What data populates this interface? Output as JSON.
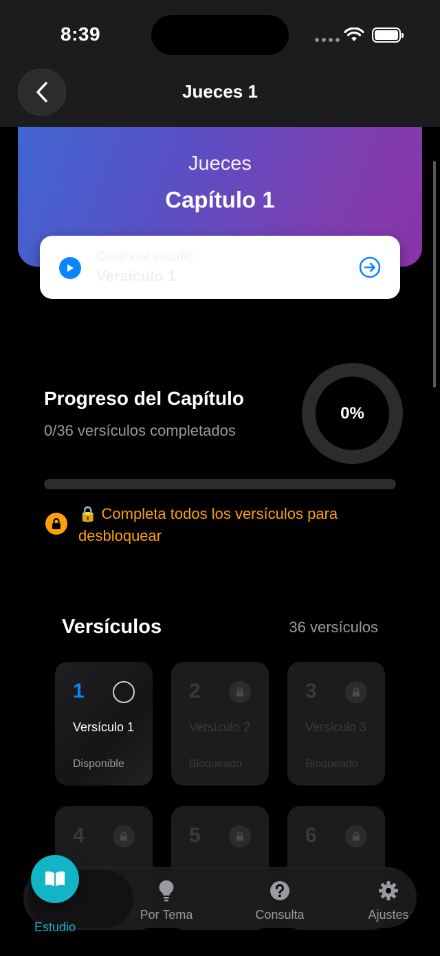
{
  "status": {
    "time": "8:39"
  },
  "nav": {
    "title": "Jueces 1"
  },
  "hero": {
    "book": "Jueces",
    "chapter": "Capítulo 1"
  },
  "continue": {
    "label": "Continuar estudio",
    "verse": "Versículo 1"
  },
  "progress": {
    "title": "Progreso del Capítulo",
    "subtitle": "0/36 versículos completados",
    "percent_label": "0%",
    "percent": 0,
    "lock_message": "🔒 Completa todos los versículos para desbloquear"
  },
  "verses": {
    "title": "Versículos",
    "count": "36 versículos",
    "items": [
      {
        "number": "1",
        "label": "Versículo 1",
        "status": "Disponible",
        "state": "available"
      },
      {
        "number": "2",
        "label": "Versículo 2",
        "status": "Bloqueado",
        "state": "locked"
      },
      {
        "number": "3",
        "label": "Versículo 3",
        "status": "Bloqueado",
        "state": "locked"
      },
      {
        "number": "4",
        "label": "",
        "status": "",
        "state": "locked"
      },
      {
        "number": "5",
        "label": "",
        "status": "",
        "state": "locked"
      },
      {
        "number": "6",
        "label": "",
        "status": "",
        "state": "locked"
      }
    ]
  },
  "tabs": {
    "study": "Estudio",
    "topic": "Por Tema",
    "consult": "Consulta",
    "settings": "Ajustes"
  },
  "colors": {
    "accent": "#0a84ff",
    "teal": "#12b5c7",
    "warning": "#ff9f0a"
  }
}
